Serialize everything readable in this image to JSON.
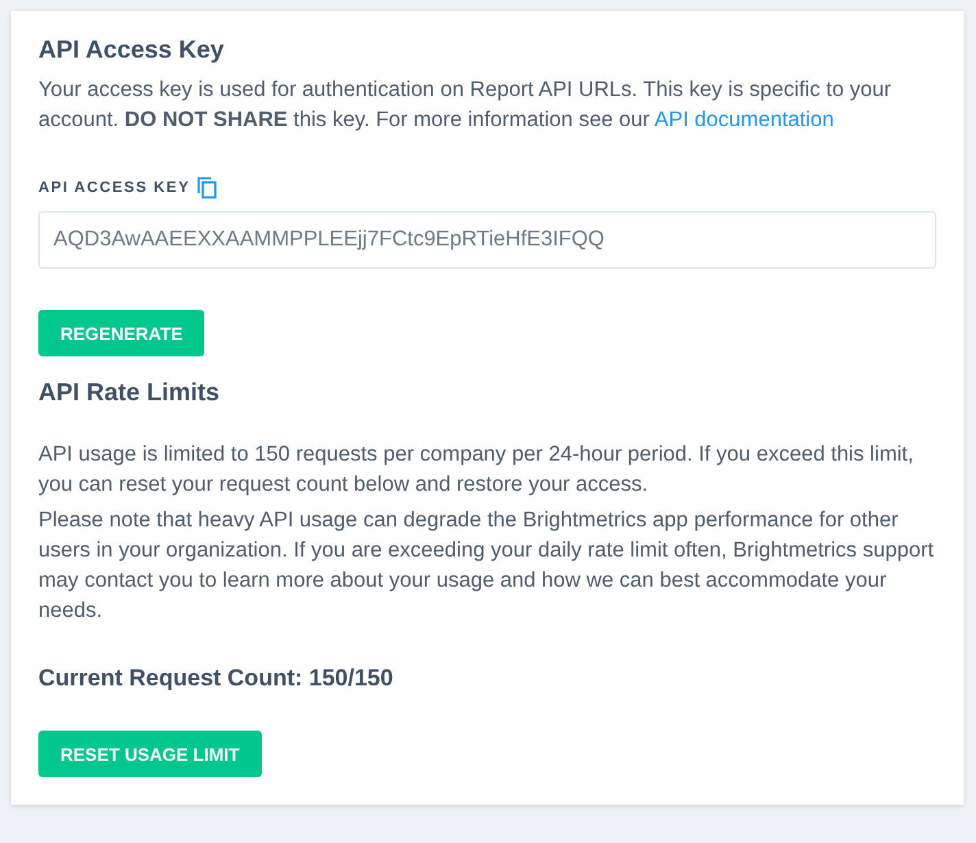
{
  "access_key_section": {
    "title": "API Access Key",
    "description": "Your access key is used for authentication on Report API URLs. This key is specific to your account. **DO NOT SHARE** this key. For more information see our",
    "docs_link": "API documentation",
    "field_label": "API ACCESS KEY",
    "key_value": "AQD3AwAAEEXXAAMMPPLEEjj7FCtc9EpRTieHfE3IFQQ",
    "button": "REGENERATE"
  },
  "rate_limit_section": {
    "title": "API Rate Limits",
    "paragraphs": [
      "API usage is limited to 150 requests per company per 24-hour period. If you exceed this limit, you can reset your request count below and restore your access.",
      "Please note that heavy API usage can degrade the Brightmetrics app performance for other users in your organization. If you are exceeding your daily rate limit often, Brightmetrics support may contact you to learn more about your usage and how we can best accommodate your needs."
    ],
    "count_label": "Current Request Count: 150/150",
    "button": "RESET USAGE LIMIT"
  }
}
